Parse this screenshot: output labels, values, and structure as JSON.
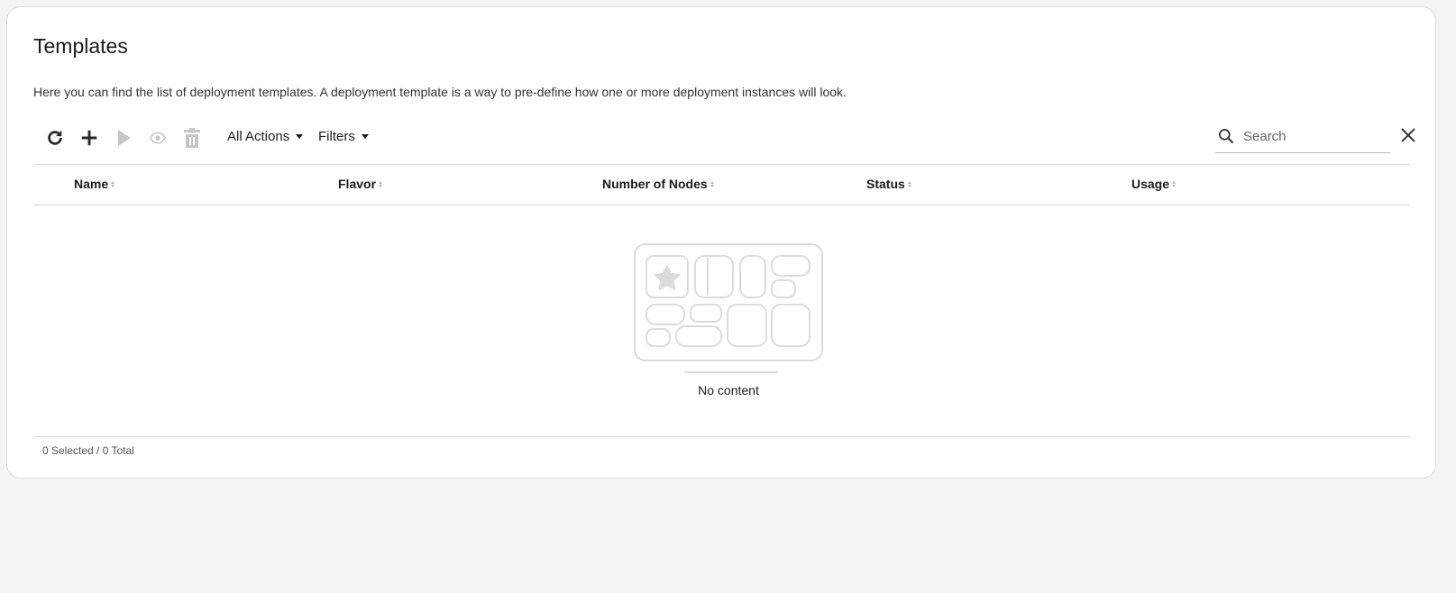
{
  "page": {
    "title": "Templates",
    "description": "Here you can find the list of deployment templates. A deployment template is a way to pre-define how one or more deployment instances will look."
  },
  "toolbar": {
    "icons": [
      "refresh-icon",
      "add-icon",
      "play-icon",
      "eye-icon",
      "trash-icon"
    ],
    "all_actions_label": "All Actions",
    "filters_label": "Filters",
    "search_placeholder": "Search"
  },
  "table": {
    "columns": [
      "Name",
      "Flavor",
      "Number of Nodes",
      "Status",
      "Usage"
    ],
    "rows": [],
    "empty_text": "No content"
  },
  "footer": {
    "selection_summary": "0 Selected / 0 Total"
  },
  "colors": {
    "background": "#f4f4f4",
    "card": "#ffffff",
    "text": "#1c1c1c",
    "icon_active": "#2b2b2b",
    "icon_disabled": "#c6c6c6",
    "illustration": "#dcdcdc"
  }
}
